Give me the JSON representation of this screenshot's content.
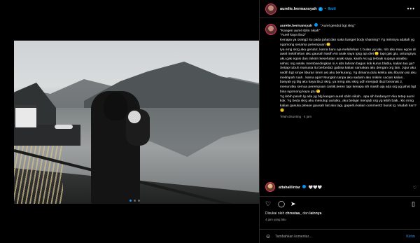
{
  "post": {
    "username": "aurelie.hermansyah",
    "follow_label": "Ikuti",
    "separator": "•",
    "more_icon": "more-icon"
  },
  "media": {
    "next_icon": "chevron-right-icon",
    "image_alt": "Woman in black hijab holding a baby beside a mountain lake"
  },
  "caption": {
    "username": "aurelie.hermansyah",
    "lines": [
      "\"Aurel gendut bgt skrg\"",
      "\"Kangen aurel sblm nikah\"",
      "\"Aurel kaya ibu2\"",
      "Kenapa ya orang2 itu pada jahat dan suka banget body shaming? Yg mirisnya adalah yg ngomong sesama perempuan 🙁",
      "Iya emg skrg aku gendut, karna baru aja melahirkan 1 bulan yg lalu. Ido aku mau egois dr awal melahirkan aku gausah kasih Asi anak saya Igsg aja diet 🙁 tapi gak gtu, untungnya aku gak egois dan mikirin kesehatan anak saya. kasih Asi yg terbaik supaya anakku sehat, org selalu membandingkan si A abs lahiran bagus kok kurus blabla, kalian tau ga? Setiap tubuh manusia itu berbeda2 gabisa kalian samakan aku dengan org lain. Jujur aku sedih bgt smpe liburan kmrn asi aku berkurang. Yg dimana dulu ketika aku liburan asi aku melimpah ruah.. karna apa? Mungkin tanpa aku sadarin aku mikirin cacian kalian..",
      "banyak yg blg aku kaya ibu2 skrg. ya mmg aku skrg udh menjadi ibu2 beranak 2, menurutku semua perempuan cantik,keren tapi kenapa sih masih aja ada org yg jahat bgt bisa ngomong kaya gtu 🙁",
      "Yg lebih parah lg ada yg blg kangen aurel sblm nikah.. apa sih bedanya? Aku tetep aurel kok. Yg beda skrg aku menutup auratku, aku belajar menjadi org yg lebih baik.. klo mmg kalian gasuka please gausah liat aku lagi, gaperlu kalian comment2 buruk lg. Mudah kan? 😊"
    ],
    "edited": "Telah disunting · 4 jam"
  },
  "comment": {
    "username": "attahalilintar",
    "text": "🤍🤍🤍"
  },
  "likes": {
    "prefix": "Disukai oleh",
    "user": "chrsstaa_",
    "and": "dan",
    "others": "lainnya"
  },
  "time": "4 jam yang lalu",
  "comment_input": {
    "placeholder": "Tambahkan komentar...",
    "send_label": "Kirim"
  },
  "icons": {
    "like": "heart-icon",
    "comment": "comment-icon",
    "share": "share-icon",
    "save": "bookmark-icon",
    "emoji": "emoji-icon"
  }
}
